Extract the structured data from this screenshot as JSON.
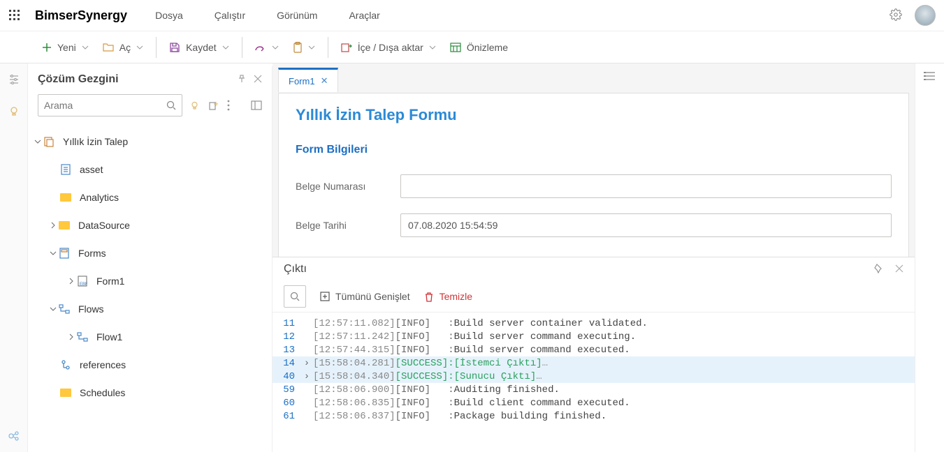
{
  "brand": "BimserSynergy",
  "topmenu": {
    "dosya": "Dosya",
    "calistir": "Çalıştır",
    "gorunum": "Görünüm",
    "araclar": "Araçlar"
  },
  "toolbar": {
    "yeni": "Yeni",
    "ac": "Aç",
    "kaydet": "Kaydet",
    "iceDisa": "İçe / Dışa aktar",
    "onizleme": "Önizleme"
  },
  "explorer": {
    "title": "Çözüm Gezgini",
    "search_placeholder": "Arama",
    "tree": {
      "root": "Yıllık İzin Talep",
      "asset": "asset",
      "analytics": "Analytics",
      "datasource": "DataSource",
      "forms": "Forms",
      "form1": "Form1",
      "flows": "Flows",
      "flow1": "Flow1",
      "references": "references",
      "schedules": "Schedules"
    }
  },
  "tabs": {
    "form1": "Form1"
  },
  "form": {
    "title": "Yıllık İzin Talep Formu",
    "section": "Form Bilgileri",
    "field_num_label": "Belge Numarası",
    "field_date_label": "Belge Tarihi",
    "field_date_value": "07.08.2020 15:54:59"
  },
  "output": {
    "title": "Çıktı",
    "search_placeholder": "Arama",
    "expand_all": "Tümünü Genişlet",
    "clear": "Temizle",
    "lines": [
      {
        "n": "11",
        "ts": "[12:57:11.082]",
        "lvl": "[INFO]",
        "sep": ": ",
        "msg": "Build server container validated.",
        "type": "info"
      },
      {
        "n": "12",
        "ts": "[12:57:11.242]",
        "lvl": "[INFO]",
        "sep": ": ",
        "msg": "Build server command executing.",
        "type": "info"
      },
      {
        "n": "13",
        "ts": "[12:57:44.315]",
        "lvl": "[INFO]",
        "sep": ": ",
        "msg": "Build server command executed.",
        "type": "info"
      },
      {
        "n": "14",
        "expand": true,
        "ts": "[15:58:04.281]",
        "lvl": "[SUCCESS]:",
        "sep": " ",
        "msg": "[İstemci Çıktı]",
        "type": "success",
        "dots": "…",
        "sel": true
      },
      {
        "n": "40",
        "expand": true,
        "ts": "[15:58:04.340]",
        "lvl": "[SUCCESS]:",
        "sep": " ",
        "msg": "[Sunucu Çıktı]",
        "type": "success",
        "dots": "…",
        "sel": true
      },
      {
        "n": "59",
        "ts": "[12:58:06.900]",
        "lvl": "[INFO]",
        "sep": ": ",
        "msg": "Auditing finished.",
        "type": "info"
      },
      {
        "n": "60",
        "ts": "[12:58:06.835]",
        "lvl": "[INFO]",
        "sep": ": ",
        "msg": "Build client command executed.",
        "type": "info"
      },
      {
        "n": "61",
        "ts": "[12:58:06.837]",
        "lvl": "[INFO]",
        "sep": ": ",
        "msg": "Package building finished.",
        "type": "info"
      }
    ]
  }
}
